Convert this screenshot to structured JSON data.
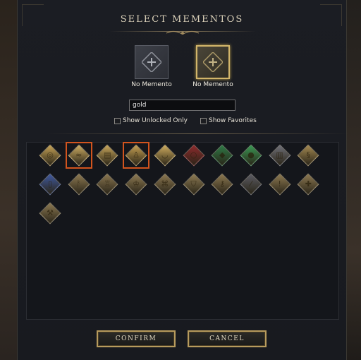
{
  "dialog": {
    "title": "SELECT MEMENTOS"
  },
  "slots": [
    {
      "label": "No Memento",
      "icon": "plus-icon",
      "selected": false
    },
    {
      "label": "No Memento",
      "icon": "plus-icon",
      "selected": true
    }
  ],
  "search": {
    "value": "gold",
    "placeholder": ""
  },
  "filters": {
    "unlocked_label": "Show Unlocked Only",
    "favorites_label": "Show Favorites"
  },
  "mementos": [
    {
      "color": "#c8a457",
      "glyph": "coin-icon",
      "selected": false
    },
    {
      "color": "#cfae62",
      "glyph": "boat-icon",
      "selected": true
    },
    {
      "color": "#c9a65a",
      "glyph": "scroll-icon",
      "selected": false
    },
    {
      "color": "#c7a152",
      "glyph": "figure-icon",
      "selected": true
    },
    {
      "color": "#d0ad5e",
      "glyph": "bowl-icon",
      "selected": false
    },
    {
      "color": "#8e2a2c",
      "glyph": "ring-icon",
      "selected": false
    },
    {
      "color": "#2e7b47",
      "glyph": "gem-icon",
      "selected": false
    },
    {
      "color": "#3a9a55",
      "glyph": "orb-icon",
      "selected": false
    },
    {
      "color": "#6f7079",
      "glyph": "book-icon",
      "selected": false
    },
    {
      "color": "#a58a52",
      "glyph": "rope-icon",
      "selected": false
    },
    {
      "color": "#3f59a0",
      "glyph": "jar-icon",
      "selected": false
    },
    {
      "color": "#8e7a52",
      "glyph": "claw-icon",
      "selected": false
    },
    {
      "color": "#8a7650",
      "glyph": "lantern-icon",
      "selected": false
    },
    {
      "color": "#8f7b53",
      "glyph": "crown-icon",
      "selected": false
    },
    {
      "color": "#8d7952",
      "glyph": "map-icon",
      "selected": false
    },
    {
      "color": "#8f7c54",
      "glyph": "shield-icon",
      "selected": false
    },
    {
      "color": "#8c7850",
      "glyph": "key-icon",
      "selected": false
    },
    {
      "color": "#5a5b63",
      "glyph": "blade-icon",
      "selected": false
    },
    {
      "color": "#8e7a51",
      "glyph": "vial-icon",
      "selected": false
    },
    {
      "color": "#8d7951",
      "glyph": "cross-icon",
      "selected": false
    },
    {
      "color": "#8c7952",
      "glyph": "axe-icon",
      "selected": false
    }
  ],
  "buttons": {
    "confirm": "CONFIRM",
    "cancel": "CANCEL"
  }
}
